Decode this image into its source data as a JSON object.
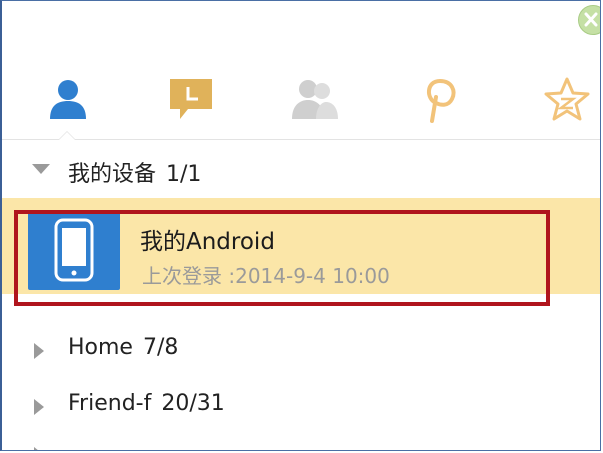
{
  "window": {
    "close_icon": "close-icon"
  },
  "tabs": [
    {
      "icon": "contacts-icon",
      "color": "#2f7fcf",
      "active": true
    },
    {
      "icon": "message-icon",
      "color": "#e0b25a",
      "active": false
    },
    {
      "icon": "group-icon",
      "color": "#cfcfcf",
      "active": false
    },
    {
      "icon": "discover-icon",
      "color": "#f2c37a",
      "active": false
    },
    {
      "icon": "favorites-icon",
      "color": "#f2c37a",
      "active": false
    }
  ],
  "groups": {
    "my_devices": {
      "label": "我的设备",
      "count": "1/1",
      "device": {
        "name": "我的Android",
        "last_login": "上次登录 :2014-9-4 10:00",
        "icon": "phone-icon"
      }
    },
    "home": {
      "label": "Home",
      "count": "7/8"
    },
    "friend": {
      "label": "Friend-f",
      "count": "20/31"
    }
  },
  "colors": {
    "selected_row": "#fbe6a8",
    "highlight_border": "#b0151d",
    "accent_blue": "#2f7fcf"
  }
}
